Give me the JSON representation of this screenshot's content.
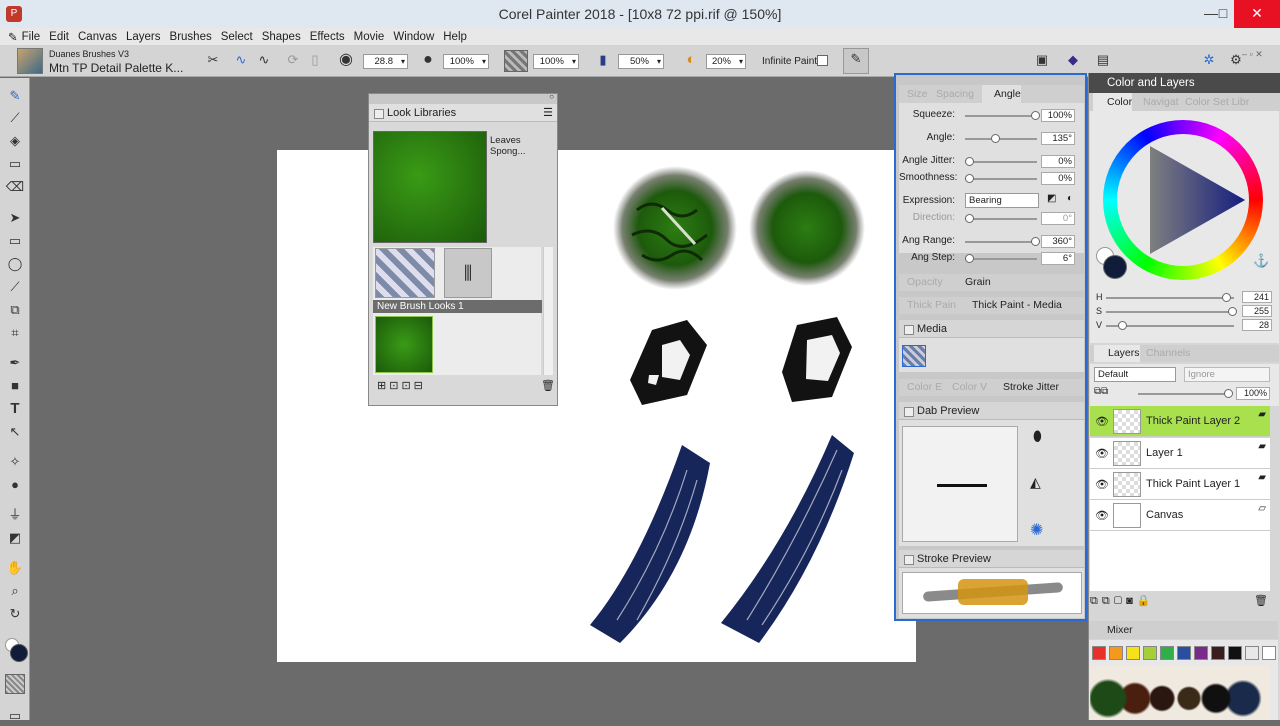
{
  "window": {
    "title": "Corel Painter 2018 - [10x8 72 ppi.rif @ 150%]",
    "min": "—",
    "max": "□",
    "close": "✕"
  },
  "menu": [
    "File",
    "Edit",
    "Canvas",
    "Layers",
    "Brushes",
    "Select",
    "Shapes",
    "Effects",
    "Movie",
    "Window",
    "Help"
  ],
  "brush": {
    "category": "Duanes Brushes V3",
    "variant": "Mtn TP Detail Palette K..."
  },
  "property_bar": {
    "size": "28.8",
    "opacity": "100%",
    "grain": "100%",
    "resat": "50%",
    "bleed": "20%",
    "infinite_paint": "Infinite Paint"
  },
  "look_libraries": {
    "title": "Look Libraries",
    "look_name": "Leaves Spong...",
    "library": "New Brush Looks 1"
  },
  "brush_controls": {
    "tabs": [
      "Size",
      "Spacing",
      "Angle"
    ],
    "sliders": [
      {
        "label": "Squeeze:",
        "value": "100%",
        "frac": 1.0
      },
      {
        "label": "Angle:",
        "value": "135°",
        "frac": 0.4
      },
      {
        "label": "Angle Jitter:",
        "value": "0%",
        "frac": 0
      },
      {
        "label": "Smoothness:",
        "value": "0%",
        "frac": 0
      },
      {
        "label": "Direction:",
        "value": "0°",
        "frac": 0
      },
      {
        "label": "Ang Range:",
        "value": "360°",
        "frac": 1.0
      },
      {
        "label": "Ang Step:",
        "value": "6°",
        "frac": 0
      }
    ],
    "expression_label": "Expression:",
    "expression_value": "Bearing",
    "opacity_tab": "Opacity",
    "grain_tab": "Grain",
    "thick_tab": "Thick Pain",
    "thick_media": "Thick Paint - Media",
    "media": "Media",
    "color_e": "Color E",
    "color_v": "Color V",
    "stroke_jitter": "Stroke Jitter",
    "dab_preview": "Dab Preview",
    "stroke_preview": "Stroke Preview"
  },
  "color_panel": {
    "title": "Color and Layers",
    "tabs": [
      "Color",
      "Navigat",
      "Color Set Libr"
    ],
    "hsv": [
      {
        "k": "H",
        "v": "241",
        "frac": 0.95
      },
      {
        "k": "S",
        "v": "255",
        "frac": 1.0
      },
      {
        "k": "V",
        "v": "28",
        "frac": 0.1
      }
    ]
  },
  "layers": {
    "tabs": [
      "Layers",
      "Channels"
    ],
    "composite": "Default",
    "preserve": "Ignore",
    "opacity": "100%",
    "items": [
      {
        "name": "Thick Paint Layer 2",
        "selected": true
      },
      {
        "name": "Layer 1"
      },
      {
        "name": "Thick Paint Layer 1"
      },
      {
        "name": "Canvas"
      }
    ]
  },
  "mixer": {
    "title": "Mixer",
    "colors": [
      "#e8302a",
      "#f39a1e",
      "#f7e11a",
      "#a6cd3a",
      "#2fae4a",
      "#2b4fa0",
      "#7b2a8a",
      "#3a1d1d",
      "#111111",
      "#e8e8e8",
      "#ffffff"
    ]
  }
}
